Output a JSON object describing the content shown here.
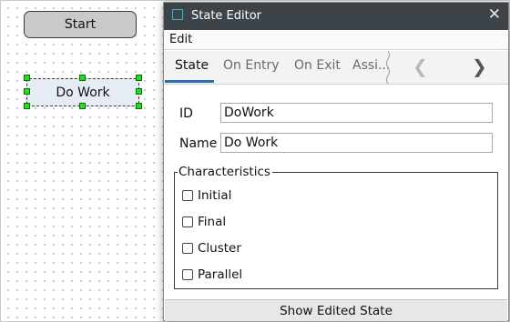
{
  "canvas": {
    "nodes": [
      {
        "label": "Start"
      },
      {
        "label": "Do Work"
      }
    ]
  },
  "dialog": {
    "title": "State Editor",
    "close_glyph": "✕",
    "menu": {
      "edit": "Edit"
    },
    "tabs": [
      "State",
      "On Entry",
      "On Exit",
      "Assi..."
    ],
    "nav": {
      "prev": "❮",
      "next": "❯"
    },
    "fields": {
      "id_label": "ID",
      "id_value": "DoWork",
      "name_label": "Name",
      "name_value": "Do Work"
    },
    "characteristics": {
      "title": "Characteristics",
      "options": [
        "Initial",
        "Final",
        "Cluster",
        "Parallel"
      ]
    },
    "show_button": "Show Edited State"
  },
  "colors": {
    "titlebar": "#3d4449",
    "accent": "#2b6fb3",
    "selection_handle": "#22dd22",
    "title_icon": "#33b6d6"
  }
}
